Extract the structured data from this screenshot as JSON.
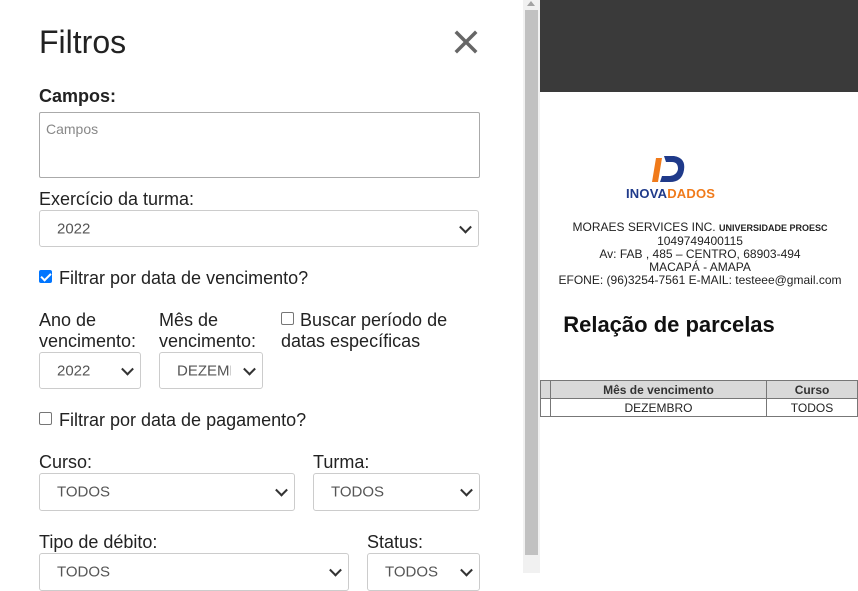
{
  "filters": {
    "title": "Filtros",
    "close_icon": "close-icon",
    "campos": {
      "label": "Campos:",
      "placeholder": "Campos"
    },
    "exercicio": {
      "label": "Exercício da turma:",
      "value": "2022"
    },
    "filtrar_vencimento": {
      "label": "Filtrar por data de vencimento?",
      "checked": true
    },
    "ano_vencimento": {
      "label_line1": "Ano de",
      "label_line2": "vencimento:",
      "value": "2022"
    },
    "mes_vencimento": {
      "label_line1": "Mês de",
      "label_line2": "vencimento:",
      "value": "DEZEMBRO"
    },
    "buscar_periodo": {
      "label_line1": "Buscar período de",
      "label_line2": "datas específicas",
      "checked": false
    },
    "filtrar_pagamento": {
      "label": "Filtrar por data de pagamento?",
      "checked": false
    },
    "curso": {
      "label": "Curso:",
      "value": "TODOS"
    },
    "turma": {
      "label": "Turma:",
      "value": "TODOS"
    },
    "tipo_debito": {
      "label": "Tipo de débito:",
      "value": "TODOS"
    },
    "status": {
      "label": "Status:",
      "value": "TODOS"
    }
  },
  "report": {
    "logo_text_a": "INOVA",
    "logo_text_b": "DADOS",
    "company_name": "MORAES SERVICES INC.",
    "company_unit": "UNIVERSIDADE PROESC",
    "phone_id": "1049749400115",
    "address": "Av: FAB , 485 – CENTRO, 68903-494",
    "city": "MACAPÁ - AMAPA",
    "contact": "EFONE: (96)3254-7561 E-MAIL: testeee@gmail.com",
    "title": "Relação de parcelas",
    "table": {
      "headers": [
        "",
        "Mês de vencimento",
        "Curso"
      ],
      "rows": [
        [
          "",
          "DEZEMBRO",
          "TODOS"
        ]
      ]
    }
  },
  "colors": {
    "accent": "#0075ff",
    "logo_blue": "#1f3a8a",
    "logo_orange": "#f07a1a",
    "header_bar": "#3a3a3a"
  }
}
